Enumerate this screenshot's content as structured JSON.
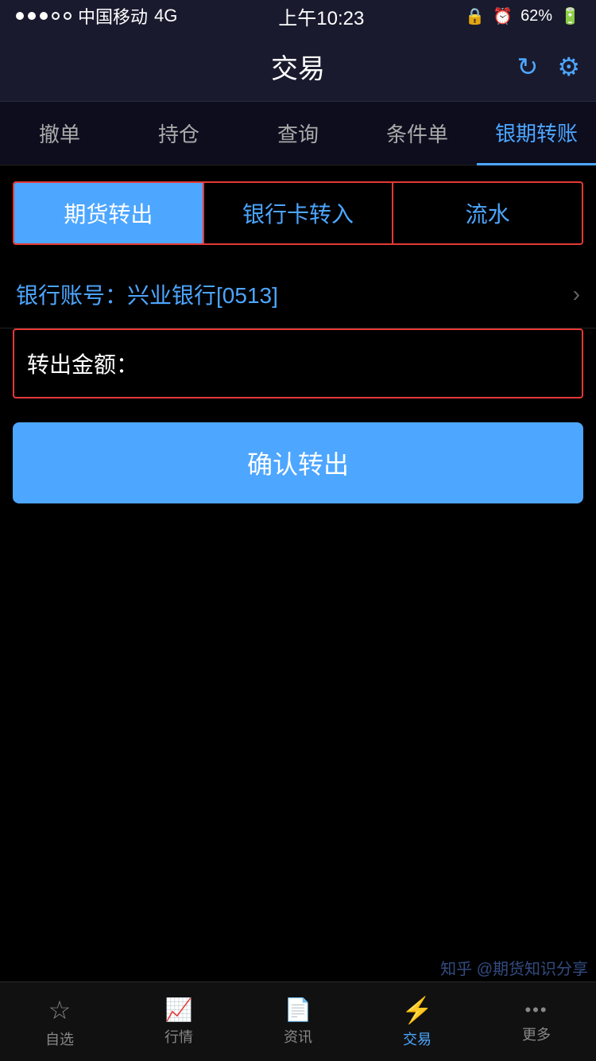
{
  "statusBar": {
    "carrier": "中国移动",
    "network": "4G",
    "time": "上午10:23",
    "battery": "62%"
  },
  "navBar": {
    "title": "交易",
    "refreshIcon": "↻",
    "settingsIcon": "⚙"
  },
  "topTabs": [
    {
      "id": "撤单",
      "label": "撤单",
      "active": false
    },
    {
      "id": "持仓",
      "label": "持仓",
      "active": false
    },
    {
      "id": "查询",
      "label": "查询",
      "active": false
    },
    {
      "id": "条件单",
      "label": "条件单",
      "active": false
    },
    {
      "id": "银期转账",
      "label": "银期转账",
      "active": true
    }
  ],
  "subTabs": [
    {
      "id": "期货转出",
      "label": "期货转出",
      "active": true
    },
    {
      "id": "银行卡转入",
      "label": "银行卡转入",
      "active": false
    },
    {
      "id": "流水",
      "label": "流水",
      "active": false
    }
  ],
  "bankAccount": {
    "label": "银行账号：兴业银行",
    "code": "[0513]"
  },
  "amountField": {
    "label": "转出金额：",
    "placeholder": ""
  },
  "confirmButton": {
    "label": "确认转出"
  },
  "bottomTabs": [
    {
      "id": "自选",
      "label": "自选",
      "icon": "☆",
      "active": false
    },
    {
      "id": "行情",
      "label": "行情",
      "icon": "📈",
      "active": false
    },
    {
      "id": "资讯",
      "label": "资讯",
      "icon": "📄",
      "active": false
    },
    {
      "id": "交易",
      "label": "交易",
      "icon": "⚡",
      "active": true
    },
    {
      "id": "更多",
      "label": "更多",
      "icon": "•••",
      "active": false
    }
  ],
  "watermark": {
    "line1": "知乎 @期货知识分享",
    "line2": ""
  }
}
